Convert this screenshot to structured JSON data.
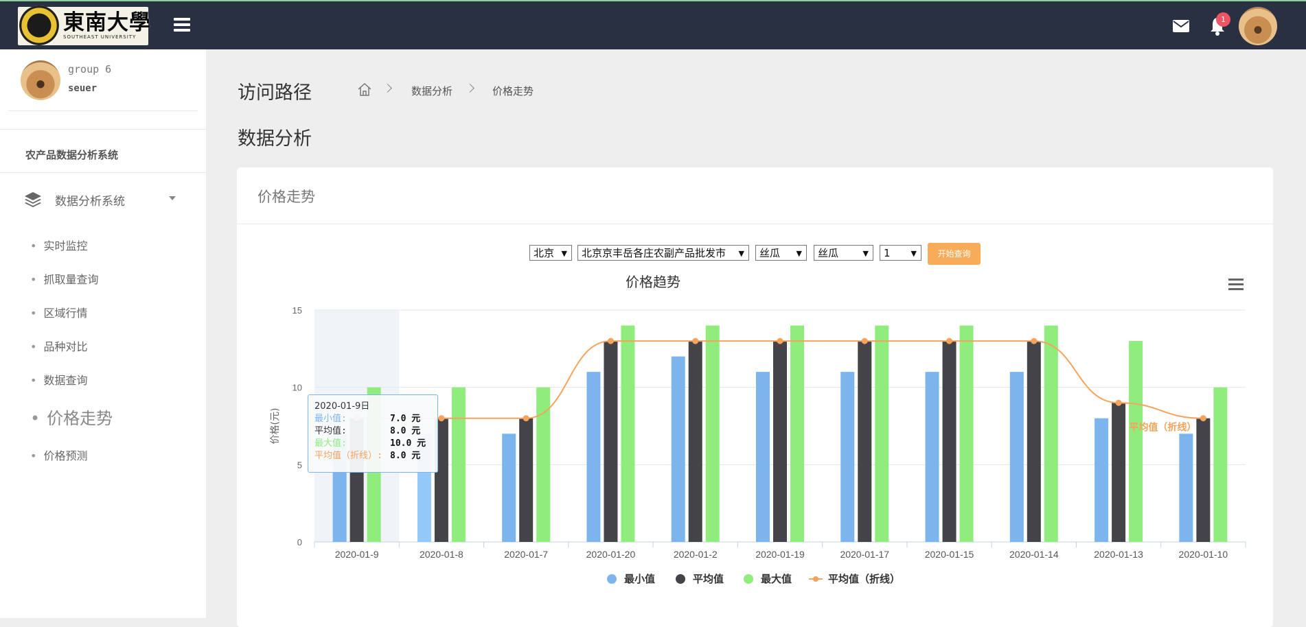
{
  "topbar": {
    "logo_cn": "東南大學",
    "logo_en": "SOUTHEAST UNIVERSITY",
    "notification_count": "1",
    "icons": [
      "menu-icon",
      "mail-icon",
      "bell-icon"
    ]
  },
  "sidebar": {
    "profile_group": "group 6",
    "profile_user": "seuer",
    "system_title": "农产品数据分析系统",
    "menu_group": "数据分析系统",
    "items": [
      {
        "label": "实时监控"
      },
      {
        "label": "抓取量查询"
      },
      {
        "label": "区域行情"
      },
      {
        "label": "品种对比"
      },
      {
        "label": "数据查询"
      },
      {
        "label": "价格走势"
      },
      {
        "label": "价格预测"
      }
    ],
    "active_item": "价格走势"
  },
  "breadcrumb": {
    "label": "访问路径",
    "level1": "数据分析",
    "level2": "价格走势"
  },
  "page_title": "数据分析",
  "panel_title": "价格走势",
  "filters": {
    "city": "北京",
    "market": "北京京丰岳各庄农副产品批发市",
    "category": "丝瓜",
    "variety": "丝瓜",
    "count": "1",
    "query_button": "开始查询"
  },
  "tooltip": {
    "date": "2020-01-9日",
    "rows": [
      {
        "label": "最小值:",
        "value": "7.0 元",
        "color": "#7cb5ec"
      },
      {
        "label": "平均值:",
        "value": "8.0 元",
        "color": "#333333"
      },
      {
        "label": "最大值:",
        "value": "10.0 元",
        "color": "#90ed7d"
      },
      {
        "label": "平均值（折线）:",
        "value": "8.0 元",
        "color": "#f7a35c"
      }
    ]
  },
  "chart_data": {
    "type": "bar",
    "title": "价格趋势",
    "ylabel": "价格(元)",
    "xlabel": "",
    "ylim": [
      0,
      15
    ],
    "yticks": [
      0,
      5,
      10,
      15
    ],
    "categories": [
      "2020-01-9",
      "2020-01-8",
      "2020-01-7",
      "2020-01-20",
      "2020-01-2",
      "2020-01-19",
      "2020-01-17",
      "2020-01-15",
      "2020-01-14",
      "2020-01-13",
      "2020-01-10"
    ],
    "series": [
      {
        "name": "最小值",
        "type": "bar",
        "color": "#7cb5ec",
        "values": [
          7,
          7,
          7,
          11,
          12,
          11,
          11,
          11,
          11,
          8,
          7
        ]
      },
      {
        "name": "平均值",
        "type": "bar",
        "color": "#434348",
        "values": [
          8,
          8,
          8,
          13,
          13,
          13,
          13,
          13,
          13,
          9,
          8
        ]
      },
      {
        "name": "最大值",
        "type": "bar",
        "color": "#90ed7d",
        "values": [
          10,
          10,
          10,
          14,
          14,
          14,
          14,
          14,
          14,
          13,
          10
        ]
      },
      {
        "name": "平均值（折线）",
        "type": "spline",
        "color": "#f7a35c",
        "values": [
          8,
          8,
          8,
          13,
          13,
          13,
          13,
          13,
          13,
          9,
          8
        ]
      }
    ],
    "line_label": "平均值（折线）",
    "highlighted_category": "2020-01-9",
    "grid": true,
    "legend": "bottom-center"
  }
}
